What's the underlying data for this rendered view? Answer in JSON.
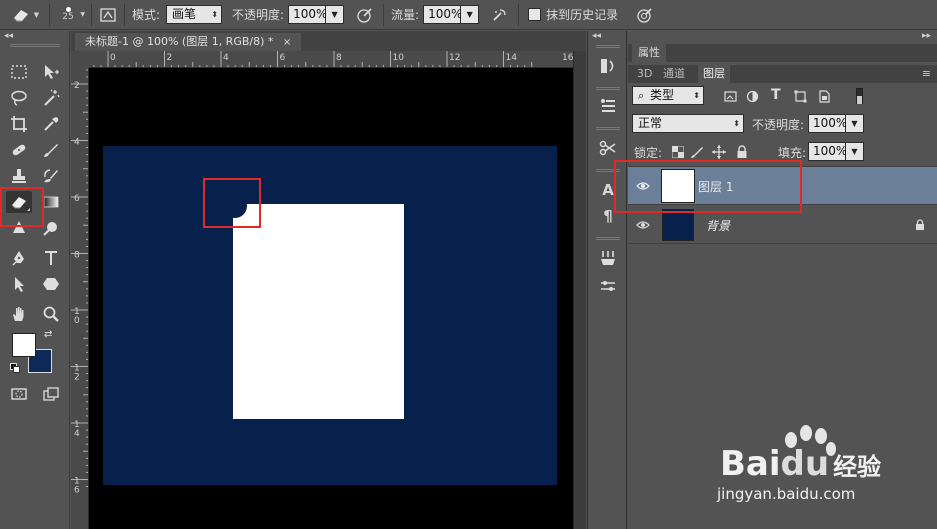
{
  "options_bar": {
    "brush_size": "25",
    "mode_label": "模式:",
    "mode_value": "画笔",
    "opacity_label": "不透明度:",
    "opacity_value": "100%",
    "flow_label": "流量:",
    "flow_value": "100%",
    "erase_history_label": "抹到历史记录"
  },
  "document": {
    "tab_title": "未标题-1 @ 100% (图层 1, RGB/8) *",
    "ruler_h_labels": [
      "0",
      "2",
      "4",
      "6",
      "8",
      "10",
      "12",
      "14",
      "16"
    ],
    "ruler_v_labels": [
      "2",
      "4",
      "6",
      "8",
      "10",
      "12",
      "14",
      "16"
    ]
  },
  "panel": {
    "properties_tab": "属性",
    "tabs": [
      "3D",
      "通道",
      "图层"
    ],
    "filter_kind": "类型",
    "blend_mode": "正常",
    "opacity_label": "不透明度:",
    "opacity_value": "100%",
    "lock_label": "锁定:",
    "fill_label": "填充:",
    "fill_value": "100%",
    "layers": [
      {
        "name": "图层 1"
      },
      {
        "name": "背景"
      }
    ]
  },
  "watermark": {
    "brand": "Bai",
    "brand_du": "du",
    "brand_cn": "经验",
    "url": "jingyan.baidu.com"
  },
  "colors": {
    "canvas_navy": "#07204c",
    "foreground": "#ffffff",
    "background": "#0d2a5a",
    "annotation_red": "#e02a2a",
    "selected_layer": "#6b7f99"
  }
}
